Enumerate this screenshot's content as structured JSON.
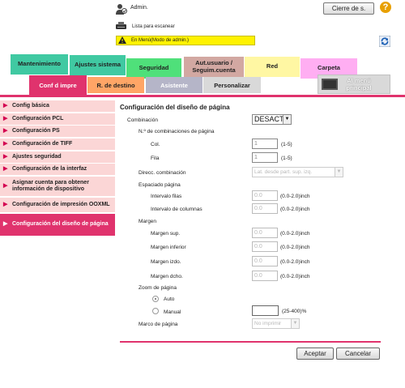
{
  "header": {
    "user_label": "Admin.",
    "logout_label": "Cierre de s.",
    "printer_status": "Lista para escanear",
    "mode_text": "En Menú(Modo de admin.)"
  },
  "tabs": [
    {
      "label": "Mantenimiento",
      "color": "#40c9a2"
    },
    {
      "label": "Ajustes sistema",
      "color": "#40c9a2"
    },
    {
      "label": "Seguridad",
      "color": "#4fe07a"
    },
    {
      "label": "Aut.usuario / Seguim.cuenta",
      "color": "#d2a8a2"
    },
    {
      "label": "Red",
      "color": "#fff7a3"
    },
    {
      "label": "Carpeta",
      "color": "#ffaef2"
    }
  ],
  "subtabs": [
    {
      "label": "Conf d impre",
      "color": "#e0336d",
      "text_color": "#ffffff"
    },
    {
      "label": "R. de destino",
      "color": "#ffa566",
      "text_color": "#222222"
    },
    {
      "label": "Asistente",
      "color": "#b5b5c8",
      "text_color": "#ffffff"
    },
    {
      "label": "Personalizar",
      "color": "#d9d9d9",
      "text_color": "#222222"
    }
  ],
  "home_label": "Al menú principal",
  "sidebar": [
    {
      "label": "Config básica"
    },
    {
      "label": "Configuración PCL"
    },
    {
      "label": "Configuración PS"
    },
    {
      "label": "Configuración de TIFF"
    },
    {
      "label": "Ajustes seguridad"
    },
    {
      "label": "Configuración de la interfaz"
    },
    {
      "label": "Asignar cuenta para obtener información de dispositivo"
    },
    {
      "label": "Configuración de impresión OOXML"
    },
    {
      "label": "Configuración del diseño de página"
    }
  ],
  "form": {
    "title": "Configuración del diseño de página",
    "combination": {
      "label": "Combinación",
      "value": "DESACT"
    },
    "num_combinations_label": "N.º de combinaciones de página",
    "col": {
      "label": "Col.",
      "value": "1",
      "range": "(1-5)"
    },
    "row": {
      "label": "Fila",
      "value": "1",
      "range": "(1-5)"
    },
    "direction": {
      "label": "Direcc. combinación",
      "value": "Lat. desde part. sup. izq."
    },
    "spacing_label": "Espaciado página",
    "interval_rows": {
      "label": "Intervalo filas",
      "value": "0.0",
      "unit": "(0.0-2.0)inch"
    },
    "interval_cols": {
      "label": "Intervalo de columnas",
      "value": "0.0",
      "unit": "(0.0-2.0)inch"
    },
    "margin_label": "Margen",
    "margin_top": {
      "label": "Margen sup.",
      "value": "0.0",
      "unit": "(0.0-2.0)inch"
    },
    "margin_bottom": {
      "label": "Margen inferior",
      "value": "0.0",
      "unit": "(0.0-2.0)inch"
    },
    "margin_left": {
      "label": "Margen izdo.",
      "value": "0.0",
      "unit": "(0.0-2.0)inch"
    },
    "margin_right": {
      "label": "Margen dcho.",
      "value": "0.0",
      "unit": "(0.0-2.0)inch"
    },
    "zoom_label": "Zoom de página",
    "zoom_auto": "Auto",
    "zoom_manual": "Manual",
    "zoom_manual_value": "",
    "zoom_range": "(25-400)%",
    "border": {
      "label": "Marco de página",
      "value": "No imprimir"
    }
  },
  "buttons": {
    "ok": "Aceptar",
    "cancel": "Cancelar"
  }
}
